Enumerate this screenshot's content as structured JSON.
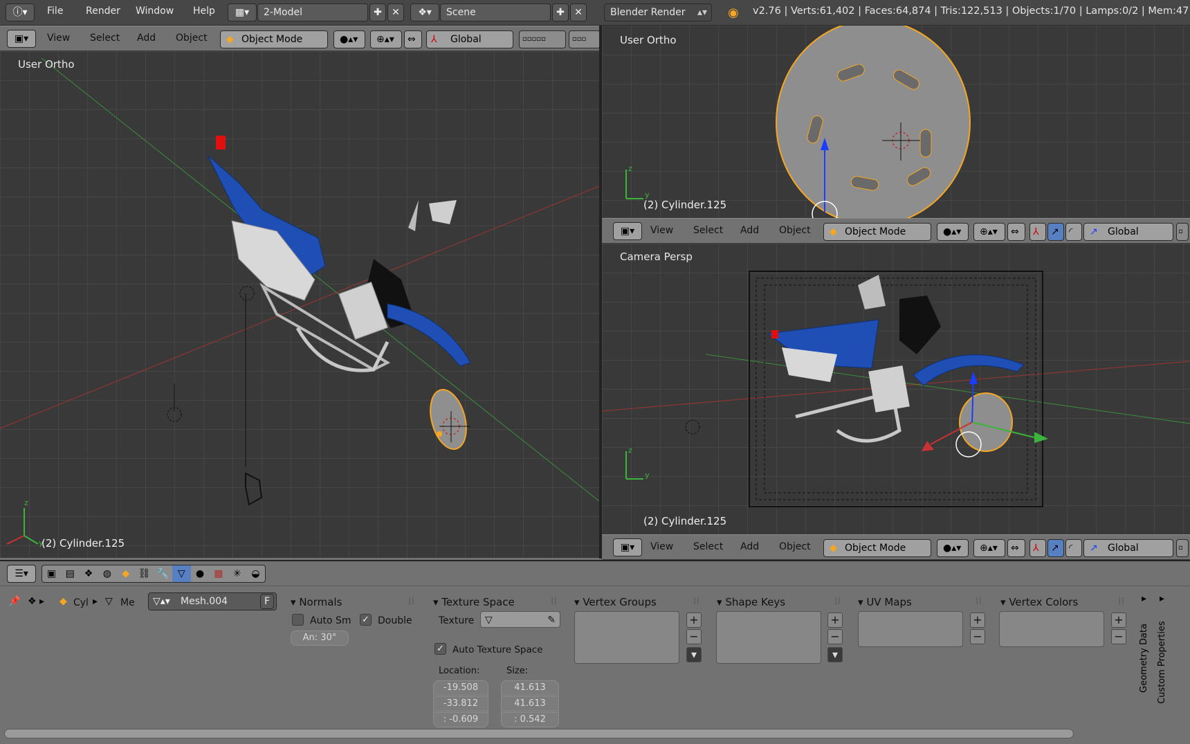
{
  "topbar": {
    "menus": [
      "File",
      "Render",
      "Window",
      "Help"
    ],
    "screen_layout": "2-Model",
    "scene": "Scene",
    "engine": "Blender Render",
    "stats": "v2.76 | Verts:61,402 | Faces:64,874 | Tris:122,513 | Objects:1/70 | Lamps:0/2 | Mem:47"
  },
  "viewport_header": {
    "menus": [
      "View",
      "Select",
      "Add",
      "Object"
    ],
    "mode": "Object Mode",
    "orientation": "Global"
  },
  "views": {
    "left": {
      "label": "User Ortho",
      "object": "(2) Cylinder.125"
    },
    "top_right": {
      "label": "User Ortho",
      "object": "(2) Cylinder.125"
    },
    "bottom_right": {
      "label": "Camera Persp",
      "object": "(2) Cylinder.125"
    }
  },
  "properties": {
    "breadcrumb": {
      "object": "Cyl",
      "mesh": "Me"
    },
    "datablock": "Mesh.004",
    "fake_user": "F",
    "normals": {
      "title": "Normals",
      "auto_smooth": "Auto Sm",
      "double_sided": "Double",
      "angle": "An: 30°"
    },
    "texture_space": {
      "title": "Texture Space",
      "texture_label": "Texture",
      "auto": "Auto Texture Space",
      "location_label": "Location:",
      "size_label": "Size:",
      "location": [
        "-19.508",
        "-33.812",
        ": -0.609"
      ],
      "size": [
        "41.613",
        "41.613",
        ":  0.542"
      ]
    },
    "vertex_groups": {
      "title": "Vertex Groups"
    },
    "shape_keys": {
      "title": "Shape Keys"
    },
    "uv_maps": {
      "title": "UV Maps"
    },
    "vertex_colors": {
      "title": "Vertex Colors"
    },
    "side_tabs": [
      "Geometry Data",
      "Custom Properties"
    ]
  },
  "colors": {
    "accent_orange": "#f5a623",
    "bike_blue": "#1f4fb5",
    "grid_red": "#c83232",
    "grid_green": "#3cb43c"
  }
}
